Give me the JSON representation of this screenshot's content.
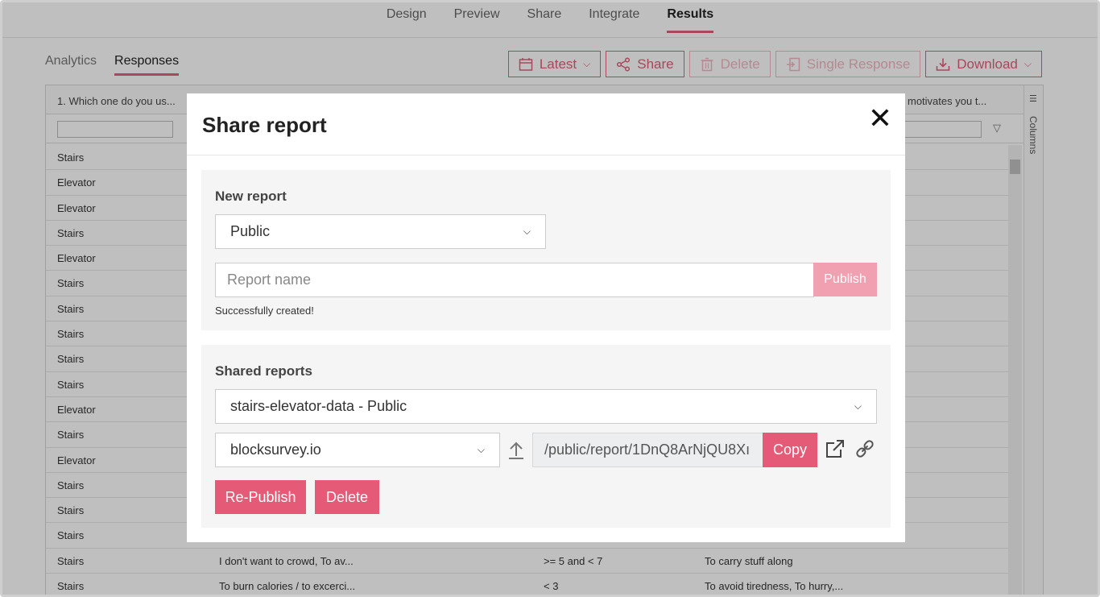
{
  "topnav": {
    "tabs": [
      "Design",
      "Preview",
      "Share",
      "Integrate",
      "Results"
    ],
    "active": "Results"
  },
  "subtabs": {
    "items": [
      "Analytics",
      "Responses"
    ],
    "active": "Responses"
  },
  "toolbar": {
    "latest": "Latest",
    "share": "Share",
    "delete": "Delete",
    "single_response": "Single Response",
    "download": "Download"
  },
  "grid": {
    "header_col1": "1. Which one do you us...",
    "header_col4": "motivates you t...",
    "columns_label": "Columns",
    "rows": [
      [
        "Stairs",
        "",
        "",
        ""
      ],
      [
        "Elevator",
        "",
        "",
        ""
      ],
      [
        "Elevator",
        "",
        "",
        ""
      ],
      [
        "Stairs",
        "",
        "",
        ""
      ],
      [
        "Elevator",
        "",
        "",
        ""
      ],
      [
        "Stairs",
        "",
        "",
        ""
      ],
      [
        "Stairs",
        "",
        "",
        ""
      ],
      [
        "Stairs",
        "",
        "",
        ""
      ],
      [
        "Stairs",
        "",
        "",
        ""
      ],
      [
        "Stairs",
        "",
        "",
        ""
      ],
      [
        "Elevator",
        "",
        "",
        ""
      ],
      [
        "Stairs",
        "",
        "",
        ""
      ],
      [
        "Elevator",
        "",
        "",
        ""
      ],
      [
        "Stairs",
        "",
        "",
        ""
      ],
      [
        "Stairs",
        "",
        "",
        ""
      ],
      [
        "Stairs",
        "",
        "",
        ""
      ],
      [
        "Stairs",
        "I don't want to crowd, To av...",
        ">= 5 and < 7",
        "To carry stuff along"
      ],
      [
        "Stairs",
        "To burn calories / to excerci...",
        "< 3",
        "To avoid tiredness, To hurry,..."
      ]
    ]
  },
  "modal": {
    "title": "Share report",
    "new_report": {
      "heading": "New report",
      "visibility": "Public",
      "name_placeholder": "Report name",
      "publish_label": "Publish",
      "status": "Successfully created!"
    },
    "shared_reports": {
      "heading": "Shared reports",
      "selected_report": "stairs-elevator-data - Public",
      "domain": "blocksurvey.io",
      "url_path": "/public/report/1DnQ8ArNjQU8Xı",
      "copy_label": "Copy",
      "republish_label": "Re-Publish",
      "delete_label": "Delete"
    }
  },
  "colors": {
    "accent": "#e55a76",
    "accent_light": "#f0a0b0"
  }
}
